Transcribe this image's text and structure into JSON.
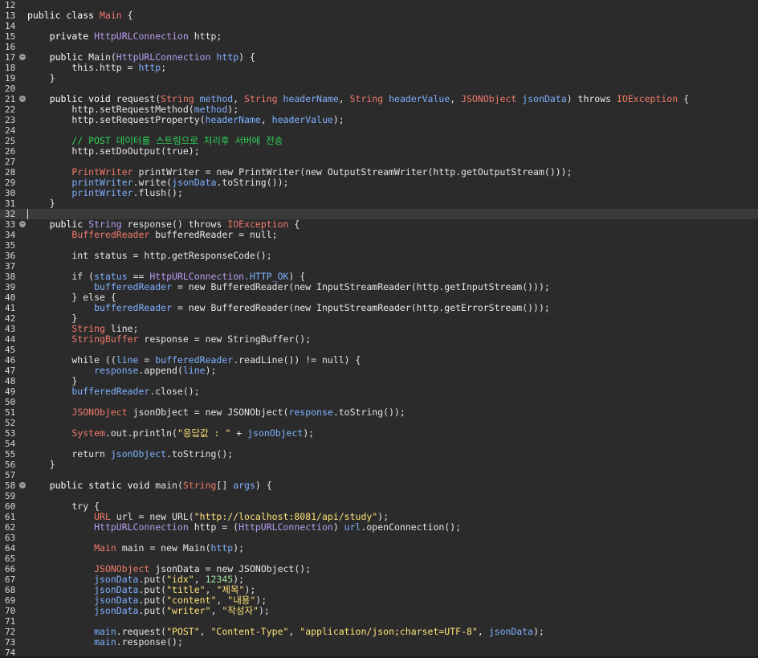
{
  "editor": {
    "current_line": 32,
    "lines": [
      {
        "n": "12",
        "fold": false,
        "tokens": []
      },
      {
        "n": "13",
        "fold": false,
        "tokens": [
          {
            "t": "public class ",
            "c": "kw"
          },
          {
            "t": "Main",
            "c": "tyr"
          },
          {
            "t": " {",
            "c": "pl"
          }
        ]
      },
      {
        "n": "14",
        "fold": false,
        "tokens": []
      },
      {
        "n": "15",
        "fold": false,
        "tokens": [
          {
            "t": "    private ",
            "c": "kw"
          },
          {
            "t": "HttpURLConnection",
            "c": "ty"
          },
          {
            "t": " http;",
            "c": "pl"
          }
        ]
      },
      {
        "n": "16",
        "fold": false,
        "tokens": []
      },
      {
        "n": "17",
        "fold": true,
        "tokens": [
          {
            "t": "    public ",
            "c": "kw"
          },
          {
            "t": "Main(",
            "c": "pl"
          },
          {
            "t": "HttpURLConnection",
            "c": "ty"
          },
          {
            "t": " http",
            "c": "vr"
          },
          {
            "t": ") {",
            "c": "pl"
          }
        ]
      },
      {
        "n": "18",
        "fold": false,
        "tokens": [
          {
            "t": "        this.http = ",
            "c": "pl"
          },
          {
            "t": "http",
            "c": "vr"
          },
          {
            "t": ";",
            "c": "pl"
          }
        ]
      },
      {
        "n": "19",
        "fold": false,
        "tokens": [
          {
            "t": "    }",
            "c": "pl"
          }
        ]
      },
      {
        "n": "20",
        "fold": false,
        "tokens": []
      },
      {
        "n": "21",
        "fold": true,
        "tokens": [
          {
            "t": "    public void ",
            "c": "kw"
          },
          {
            "t": "request(",
            "c": "pl"
          },
          {
            "t": "String",
            "c": "tyr"
          },
          {
            "t": " method",
            "c": "vr"
          },
          {
            "t": ", ",
            "c": "pl"
          },
          {
            "t": "String",
            "c": "tyr"
          },
          {
            "t": " headerName",
            "c": "vr"
          },
          {
            "t": ", ",
            "c": "pl"
          },
          {
            "t": "String",
            "c": "tyr"
          },
          {
            "t": " headerValue",
            "c": "vr"
          },
          {
            "t": ", ",
            "c": "pl"
          },
          {
            "t": "JSONObject",
            "c": "tyr"
          },
          {
            "t": " jsonData",
            "c": "vr"
          },
          {
            "t": ") throws ",
            "c": "pl"
          },
          {
            "t": "IOException",
            "c": "tyr"
          },
          {
            "t": " {",
            "c": "pl"
          }
        ]
      },
      {
        "n": "22",
        "fold": false,
        "tokens": [
          {
            "t": "        http.setRequestMethod(",
            "c": "pl"
          },
          {
            "t": "method",
            "c": "vr"
          },
          {
            "t": ");",
            "c": "pl"
          }
        ]
      },
      {
        "n": "23",
        "fold": false,
        "tokens": [
          {
            "t": "        http.setRequestProperty(",
            "c": "pl"
          },
          {
            "t": "headerName",
            "c": "vr"
          },
          {
            "t": ", ",
            "c": "pl"
          },
          {
            "t": "headerValue",
            "c": "vr"
          },
          {
            "t": ");",
            "c": "pl"
          }
        ]
      },
      {
        "n": "24",
        "fold": false,
        "tokens": []
      },
      {
        "n": "25",
        "fold": false,
        "tokens": [
          {
            "t": "        // POST 데이터를 스트림으로 처리후 서버에 전송",
            "c": "cm"
          }
        ]
      },
      {
        "n": "26",
        "fold": false,
        "tokens": [
          {
            "t": "        http.setDoOutput(true);",
            "c": "pl"
          }
        ]
      },
      {
        "n": "27",
        "fold": false,
        "tokens": []
      },
      {
        "n": "28",
        "fold": false,
        "tokens": [
          {
            "t": "        ",
            "c": "pl"
          },
          {
            "t": "PrintWriter",
            "c": "tyr"
          },
          {
            "t": " printWriter = new PrintWriter(new OutputStreamWriter(http.getOutputStream()));",
            "c": "pl"
          }
        ]
      },
      {
        "n": "29",
        "fold": false,
        "tokens": [
          {
            "t": "        printWriter",
            "c": "vr"
          },
          {
            "t": ".write(",
            "c": "pl"
          },
          {
            "t": "jsonData",
            "c": "vr"
          },
          {
            "t": ".toString());",
            "c": "pl"
          }
        ]
      },
      {
        "n": "30",
        "fold": false,
        "tokens": [
          {
            "t": "        printWriter",
            "c": "vr"
          },
          {
            "t": ".flush();",
            "c": "pl"
          }
        ]
      },
      {
        "n": "31",
        "fold": false,
        "tokens": [
          {
            "t": "    }",
            "c": "pl"
          }
        ]
      },
      {
        "n": "32",
        "fold": false,
        "tokens": []
      },
      {
        "n": "33",
        "fold": true,
        "tokens": [
          {
            "t": "    public ",
            "c": "kw"
          },
          {
            "t": "String",
            "c": "ty"
          },
          {
            "t": " response() throws ",
            "c": "pl"
          },
          {
            "t": "IOException",
            "c": "tyr"
          },
          {
            "t": " {",
            "c": "pl"
          }
        ]
      },
      {
        "n": "34",
        "fold": false,
        "tokens": [
          {
            "t": "        ",
            "c": "pl"
          },
          {
            "t": "BufferedReader",
            "c": "tyr"
          },
          {
            "t": " bufferedReader = null;",
            "c": "pl"
          }
        ]
      },
      {
        "n": "35",
        "fold": false,
        "tokens": []
      },
      {
        "n": "36",
        "fold": false,
        "tokens": [
          {
            "t": "        int status = http.getResponseCode();",
            "c": "pl"
          }
        ]
      },
      {
        "n": "37",
        "fold": false,
        "tokens": []
      },
      {
        "n": "38",
        "fold": false,
        "tokens": [
          {
            "t": "        if (",
            "c": "pl"
          },
          {
            "t": "status",
            "c": "vr"
          },
          {
            "t": " == ",
            "c": "pl"
          },
          {
            "t": "HttpURLConnection",
            "c": "ty"
          },
          {
            "t": ".HTTP_OK",
            "c": "vr"
          },
          {
            "t": ") {",
            "c": "pl"
          }
        ]
      },
      {
        "n": "39",
        "fold": false,
        "tokens": [
          {
            "t": "            bufferedReader",
            "c": "vr"
          },
          {
            "t": " = new BufferedReader(new InputStreamReader(http.getInputStream()));",
            "c": "pl"
          }
        ]
      },
      {
        "n": "40",
        "fold": false,
        "tokens": [
          {
            "t": "        } else {",
            "c": "pl"
          }
        ]
      },
      {
        "n": "41",
        "fold": false,
        "tokens": [
          {
            "t": "            bufferedReader",
            "c": "vr"
          },
          {
            "t": " = new BufferedReader(new InputStreamReader(http.getErrorStream()));",
            "c": "pl"
          }
        ]
      },
      {
        "n": "42",
        "fold": false,
        "tokens": [
          {
            "t": "        }",
            "c": "pl"
          }
        ]
      },
      {
        "n": "43",
        "fold": false,
        "tokens": [
          {
            "t": "        ",
            "c": "pl"
          },
          {
            "t": "String",
            "c": "tyr"
          },
          {
            "t": " line;",
            "c": "pl"
          }
        ]
      },
      {
        "n": "44",
        "fold": false,
        "tokens": [
          {
            "t": "        ",
            "c": "pl"
          },
          {
            "t": "StringBuffer",
            "c": "tyr"
          },
          {
            "t": " response = new StringBuffer();",
            "c": "pl"
          }
        ]
      },
      {
        "n": "45",
        "fold": false,
        "tokens": []
      },
      {
        "n": "46",
        "fold": false,
        "tokens": [
          {
            "t": "        while ((",
            "c": "pl"
          },
          {
            "t": "line",
            "c": "vr"
          },
          {
            "t": " = ",
            "c": "pl"
          },
          {
            "t": "bufferedReader",
            "c": "vr"
          },
          {
            "t": ".readLine()) != null) {",
            "c": "pl"
          }
        ]
      },
      {
        "n": "47",
        "fold": false,
        "tokens": [
          {
            "t": "            response",
            "c": "vr"
          },
          {
            "t": ".append(",
            "c": "pl"
          },
          {
            "t": "line",
            "c": "vr"
          },
          {
            "t": ");",
            "c": "pl"
          }
        ]
      },
      {
        "n": "48",
        "fold": false,
        "tokens": [
          {
            "t": "        }",
            "c": "pl"
          }
        ]
      },
      {
        "n": "49",
        "fold": false,
        "tokens": [
          {
            "t": "        bufferedReader",
            "c": "vr"
          },
          {
            "t": ".close();",
            "c": "pl"
          }
        ]
      },
      {
        "n": "50",
        "fold": false,
        "tokens": []
      },
      {
        "n": "51",
        "fold": false,
        "tokens": [
          {
            "t": "        ",
            "c": "pl"
          },
          {
            "t": "JSONObject",
            "c": "tyr"
          },
          {
            "t": " jsonObject = new JSONObject(",
            "c": "pl"
          },
          {
            "t": "response",
            "c": "vr"
          },
          {
            "t": ".toString());",
            "c": "pl"
          }
        ]
      },
      {
        "n": "52",
        "fold": false,
        "tokens": []
      },
      {
        "n": "53",
        "fold": false,
        "tokens": [
          {
            "t": "        ",
            "c": "pl"
          },
          {
            "t": "System",
            "c": "tyr"
          },
          {
            "t": ".out.println(",
            "c": "pl"
          },
          {
            "t": "\"응답값 : \"",
            "c": "st"
          },
          {
            "t": " + ",
            "c": "pl"
          },
          {
            "t": "jsonObject",
            "c": "vr"
          },
          {
            "t": ");",
            "c": "pl"
          }
        ]
      },
      {
        "n": "54",
        "fold": false,
        "tokens": []
      },
      {
        "n": "55",
        "fold": false,
        "tokens": [
          {
            "t": "        return ",
            "c": "pl"
          },
          {
            "t": "jsonObject",
            "c": "vr"
          },
          {
            "t": ".toString();",
            "c": "pl"
          }
        ]
      },
      {
        "n": "56",
        "fold": false,
        "tokens": [
          {
            "t": "    }",
            "c": "pl"
          }
        ]
      },
      {
        "n": "57",
        "fold": false,
        "tokens": []
      },
      {
        "n": "58",
        "fold": true,
        "tokens": [
          {
            "t": "    public static void ",
            "c": "kw"
          },
          {
            "t": "main(",
            "c": "pl"
          },
          {
            "t": "String",
            "c": "tyr"
          },
          {
            "t": "[] ",
            "c": "pl"
          },
          {
            "t": "args",
            "c": "vr"
          },
          {
            "t": ") {",
            "c": "pl"
          }
        ]
      },
      {
        "n": "59",
        "fold": false,
        "tokens": []
      },
      {
        "n": "60",
        "fold": false,
        "tokens": [
          {
            "t": "        try {",
            "c": "pl"
          }
        ]
      },
      {
        "n": "61",
        "fold": false,
        "tokens": [
          {
            "t": "            ",
            "c": "pl"
          },
          {
            "t": "URL",
            "c": "tyr"
          },
          {
            "t": " url = new URL(",
            "c": "pl"
          },
          {
            "t": "\"http://localhost:8081/api/study\"",
            "c": "st"
          },
          {
            "t": ");",
            "c": "pl"
          }
        ]
      },
      {
        "n": "62",
        "fold": false,
        "tokens": [
          {
            "t": "            ",
            "c": "pl"
          },
          {
            "t": "HttpURLConnection",
            "c": "ty"
          },
          {
            "t": " http = (",
            "c": "pl"
          },
          {
            "t": "HttpURLConnection",
            "c": "ty"
          },
          {
            "t": ") ",
            "c": "pl"
          },
          {
            "t": "url",
            "c": "vr"
          },
          {
            "t": ".openConnection();",
            "c": "pl"
          }
        ]
      },
      {
        "n": "63",
        "fold": false,
        "tokens": []
      },
      {
        "n": "64",
        "fold": false,
        "tokens": [
          {
            "t": "            ",
            "c": "pl"
          },
          {
            "t": "Main",
            "c": "tyr"
          },
          {
            "t": " main = new Main(",
            "c": "pl"
          },
          {
            "t": "http",
            "c": "vr"
          },
          {
            "t": ");",
            "c": "pl"
          }
        ]
      },
      {
        "n": "65",
        "fold": false,
        "tokens": []
      },
      {
        "n": "66",
        "fold": false,
        "tokens": [
          {
            "t": "            ",
            "c": "pl"
          },
          {
            "t": "JSONObject",
            "c": "tyr"
          },
          {
            "t": " jsonData = new JSONObject();",
            "c": "pl"
          }
        ]
      },
      {
        "n": "67",
        "fold": false,
        "tokens": [
          {
            "t": "            jsonData",
            "c": "vr"
          },
          {
            "t": ".put(",
            "c": "pl"
          },
          {
            "t": "\"idx\"",
            "c": "st"
          },
          {
            "t": ", ",
            "c": "pl"
          },
          {
            "t": "12345",
            "c": "nm"
          },
          {
            "t": ");",
            "c": "pl"
          }
        ]
      },
      {
        "n": "68",
        "fold": false,
        "tokens": [
          {
            "t": "            jsonData",
            "c": "vr"
          },
          {
            "t": ".put(",
            "c": "pl"
          },
          {
            "t": "\"title\"",
            "c": "st"
          },
          {
            "t": ", ",
            "c": "pl"
          },
          {
            "t": "\"제목\"",
            "c": "st"
          },
          {
            "t": ");",
            "c": "pl"
          }
        ]
      },
      {
        "n": "69",
        "fold": false,
        "tokens": [
          {
            "t": "            jsonData",
            "c": "vr"
          },
          {
            "t": ".put(",
            "c": "pl"
          },
          {
            "t": "\"content\"",
            "c": "st"
          },
          {
            "t": ", ",
            "c": "pl"
          },
          {
            "t": "\"내용\"",
            "c": "st"
          },
          {
            "t": ");",
            "c": "pl"
          }
        ]
      },
      {
        "n": "70",
        "fold": false,
        "tokens": [
          {
            "t": "            jsonData",
            "c": "vr"
          },
          {
            "t": ".put(",
            "c": "pl"
          },
          {
            "t": "\"writer\"",
            "c": "st"
          },
          {
            "t": ", ",
            "c": "pl"
          },
          {
            "t": "\"작성자\"",
            "c": "st"
          },
          {
            "t": ");",
            "c": "pl"
          }
        ]
      },
      {
        "n": "71",
        "fold": false,
        "tokens": []
      },
      {
        "n": "72",
        "fold": false,
        "tokens": [
          {
            "t": "            main",
            "c": "vr"
          },
          {
            "t": ".request(",
            "c": "pl"
          },
          {
            "t": "\"POST\"",
            "c": "st"
          },
          {
            "t": ", ",
            "c": "pl"
          },
          {
            "t": "\"Content-Type\"",
            "c": "st"
          },
          {
            "t": ", ",
            "c": "pl"
          },
          {
            "t": "\"application/json;charset=UTF-8\"",
            "c": "st"
          },
          {
            "t": ", ",
            "c": "pl"
          },
          {
            "t": "jsonData",
            "c": "vr"
          },
          {
            "t": ");",
            "c": "pl"
          }
        ]
      },
      {
        "n": "73",
        "fold": false,
        "tokens": [
          {
            "t": "            main",
            "c": "vr"
          },
          {
            "t": ".response();",
            "c": "pl"
          }
        ]
      },
      {
        "n": "74",
        "fold": false,
        "tokens": []
      }
    ]
  }
}
